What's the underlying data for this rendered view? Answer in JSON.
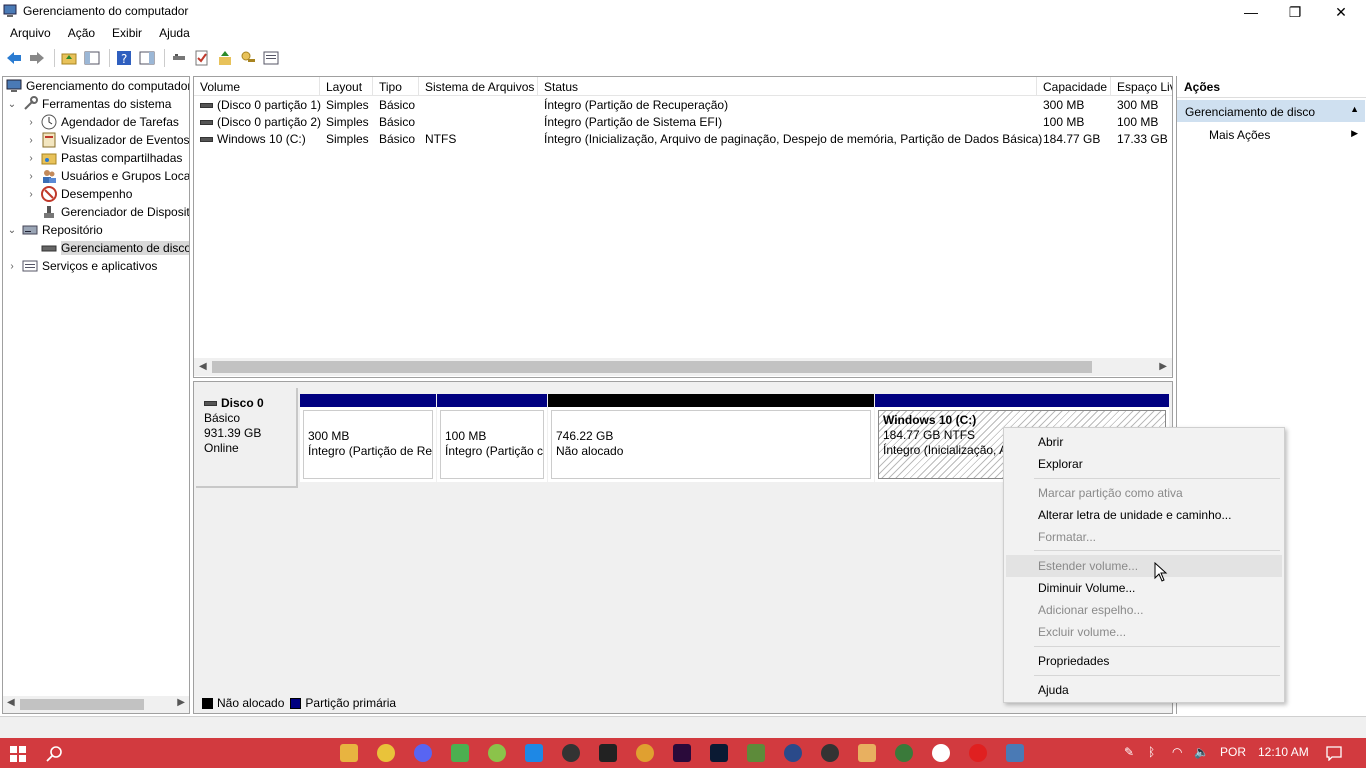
{
  "window": {
    "title": "Gerenciamento do computador",
    "controls": [
      "—",
      "❐",
      "✕"
    ]
  },
  "menu": [
    "Arquivo",
    "Ação",
    "Exibir",
    "Ajuda"
  ],
  "tree": {
    "root": "Gerenciamento do computador",
    "items": [
      {
        "label": "Ferramentas do sistema",
        "level": 1,
        "chevron": "⌄"
      },
      {
        "label": "Agendador de Tarefas",
        "level": 2,
        "chevron": "›"
      },
      {
        "label": "Visualizador de Eventos",
        "level": 2,
        "chevron": "›"
      },
      {
        "label": "Pastas compartilhadas",
        "level": 2,
        "chevron": "›"
      },
      {
        "label": "Usuários e Grupos Loca",
        "level": 2,
        "chevron": "›"
      },
      {
        "label": "Desempenho",
        "level": 2,
        "chevron": "›"
      },
      {
        "label": "Gerenciador de Disposit",
        "level": 2,
        "chevron": ""
      },
      {
        "label": "Repositório",
        "level": 1,
        "chevron": "⌄"
      },
      {
        "label": "Gerenciamento de disco",
        "level": 2,
        "chevron": "",
        "selected": true
      },
      {
        "label": "Serviços e aplicativos",
        "level": 1,
        "chevron": "›"
      }
    ]
  },
  "volume_list": {
    "columns": [
      "Volume",
      "Layout",
      "Tipo",
      "Sistema de Arquivos",
      "Status",
      "Capacidade",
      "Espaço Liv"
    ],
    "rows": [
      [
        "(Disco 0 partição 1)",
        "Simples",
        "Básico",
        "",
        "Íntegro (Partição de Recuperação)",
        "300 MB",
        "300 MB"
      ],
      [
        "(Disco 0 partição 2)",
        "Simples",
        "Básico",
        "",
        "Íntegro (Partição de Sistema EFI)",
        "100 MB",
        "100 MB"
      ],
      [
        "Windows 10 (C:)",
        "Simples",
        "Básico",
        "NTFS",
        "Íntegro (Inicialização, Arquivo de paginação, Despejo de memória, Partição de Dados Básica)",
        "184.77 GB",
        "17.33 GB"
      ]
    ]
  },
  "disk": {
    "name": "Disco 0",
    "type": "Básico",
    "size": "931.39 GB",
    "state": "Online",
    "partitions": [
      {
        "title": "",
        "line1": "300 MB",
        "line2": "Íntegro (Partição de Re",
        "bar": "#000080"
      },
      {
        "title": "",
        "line1": "100 MB",
        "line2": "Íntegro (Partição c",
        "bar": "#000080"
      },
      {
        "title": "",
        "line1": "746.22 GB",
        "line2": "Não alocado",
        "bar": "#000000"
      },
      {
        "title": "Windows 10  (C:)",
        "line1": "184.77 GB NTFS",
        "line2": "Íntegro (Inicialização, A",
        "bar": "#000080"
      }
    ]
  },
  "legend": [
    {
      "label": "Não alocado",
      "color": "#000000"
    },
    {
      "label": "Partição primária",
      "color": "#000080"
    }
  ],
  "actions": {
    "header": "Ações",
    "section": "Gerenciamento de disco",
    "item": "Mais Ações"
  },
  "context_menu": [
    {
      "label": "Abrir",
      "disabled": false
    },
    {
      "label": "Explorar",
      "disabled": false
    },
    {
      "label": "Marcar partição como ativa",
      "disabled": true
    },
    {
      "label": "Alterar letra de unidade e caminho...",
      "disabled": false
    },
    {
      "label": "Formatar...",
      "disabled": true
    },
    {
      "label": "Estender volume...",
      "disabled": true,
      "hover": true
    },
    {
      "label": "Diminuir Volume...",
      "disabled": false
    },
    {
      "label": "Adicionar espelho...",
      "disabled": true
    },
    {
      "label": "Excluir volume...",
      "disabled": true
    },
    {
      "label": "Propriedades",
      "disabled": false
    },
    {
      "label": "Ajuda",
      "disabled": false
    }
  ],
  "taskbar": {
    "language": "POR",
    "time": "12:10 AM",
    "accent": "#d23a3f"
  }
}
